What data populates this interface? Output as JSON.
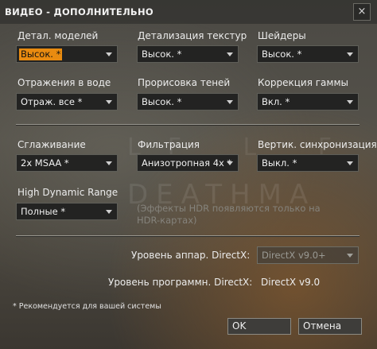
{
  "window": {
    "title": "ВИДЕО - ДОПОЛНИТЕЛЬНО",
    "close_glyph": "×"
  },
  "settings": {
    "model_detail": {
      "label": "Детал. моделей",
      "value": "Высок. *"
    },
    "texture_detail": {
      "label": "Детализация текстур",
      "value": "Высок. *"
    },
    "shaders": {
      "label": "Шейдеры",
      "value": "Высок. *"
    },
    "water_reflections": {
      "label": "Отражения в воде",
      "value": "Отраж. все *"
    },
    "shadow_detail": {
      "label": "Прорисовка теней",
      "value": "Высок. *"
    },
    "gamma_correction": {
      "label": "Коррекция гаммы",
      "value": "Вкл. *"
    },
    "antialiasing": {
      "label": "Сглаживание",
      "value": "2x MSAA *"
    },
    "filtering": {
      "label": "Фильтрация",
      "value": "Анизотропная 4x *"
    },
    "vsync": {
      "label": "Вертик. синхронизация",
      "value": "Выкл. *"
    },
    "hdr": {
      "label": "High Dynamic Range",
      "value": "Полные *"
    },
    "hdr_note": "(Эффекты HDR появляются только на HDR-картах)"
  },
  "directx": {
    "hardware_label": "Уровень аппар. DirectX:",
    "hardware_value": "DirectX v9.0+",
    "software_label": "Уровень программн. DirectX:",
    "software_value": "DirectX v9.0"
  },
  "footnote": "* Рекомендуется для вашей системы",
  "buttons": {
    "ok": "OK",
    "cancel": "Отмена"
  }
}
